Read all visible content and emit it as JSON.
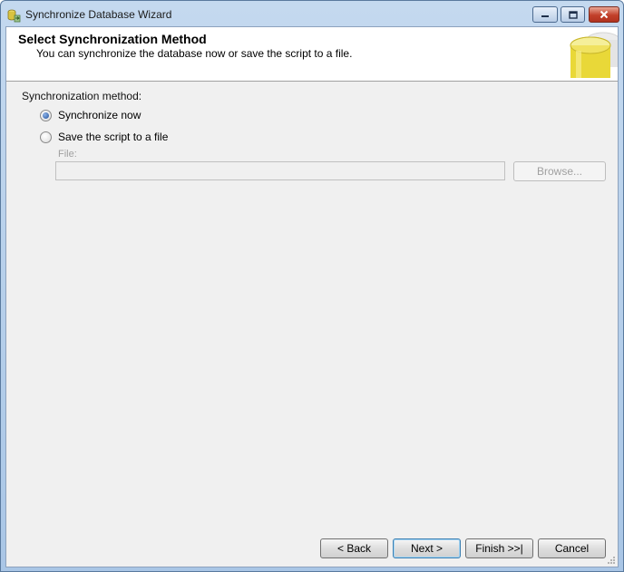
{
  "window": {
    "title": "Synchronize Database Wizard"
  },
  "header": {
    "title": "Select Synchronization Method",
    "subtitle": "You can synchronize the database now or save the script to a file."
  },
  "sync": {
    "group_label": "Synchronization method:",
    "options": [
      {
        "label": "Synchronize now",
        "checked": true
      },
      {
        "label": "Save the script to a file",
        "checked": false
      }
    ],
    "file_label": "File:",
    "file_value": "",
    "browse_label": "Browse..."
  },
  "buttons": {
    "back": "< Back",
    "next": "Next >",
    "finish": "Finish >>|",
    "cancel": "Cancel"
  },
  "icons": {
    "app": "database-sync-icon",
    "header": "database-cylinder-icon"
  },
  "colors": {
    "titlebar": "#c4d9ef",
    "close_button": "#c2402a",
    "client_background": "#f0f0f0",
    "header_background": "#ffffff"
  }
}
